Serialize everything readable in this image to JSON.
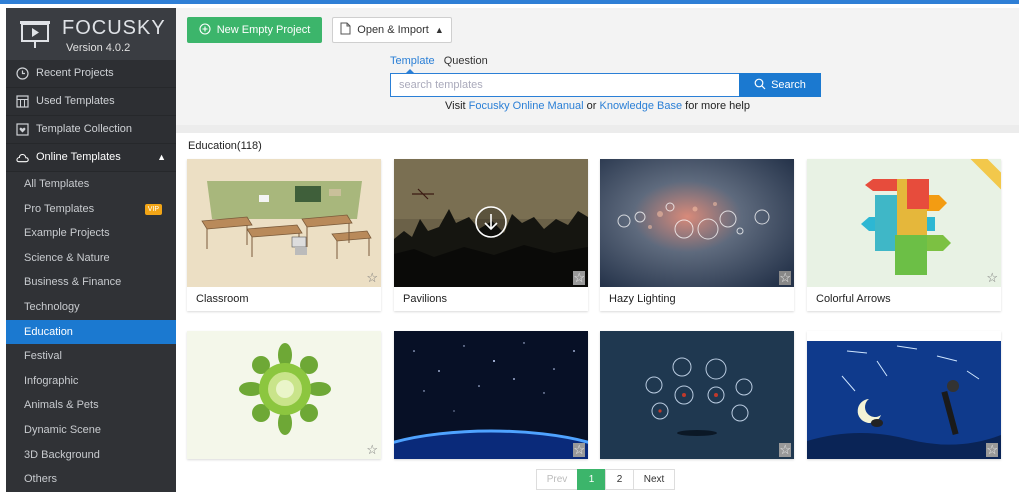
{
  "app": {
    "name": "FOCUSKY",
    "version": "Version 4.0.2"
  },
  "sidebar": {
    "items": [
      {
        "label": "Recent Projects",
        "icon": "clock-icon"
      },
      {
        "label": "Used Templates",
        "icon": "template-grid-icon"
      },
      {
        "label": "Template Collection",
        "icon": "heart-box-icon"
      },
      {
        "label": "Online Templates",
        "icon": "cloud-icon",
        "expanded": true
      }
    ],
    "sub_items": [
      {
        "label": "All Templates"
      },
      {
        "label": "Pro Templates",
        "badge": "VIP"
      },
      {
        "label": "Example Projects"
      },
      {
        "label": "Science & Nature"
      },
      {
        "label": "Business & Finance"
      },
      {
        "label": "Technology"
      },
      {
        "label": "Education",
        "active": true
      },
      {
        "label": "Festival"
      },
      {
        "label": "Infographic"
      },
      {
        "label": "Animals & Pets"
      },
      {
        "label": "Dynamic Scene"
      },
      {
        "label": "3D Background"
      },
      {
        "label": "Others"
      }
    ]
  },
  "toolbar": {
    "new_project": "New Empty Project",
    "open_import": "Open & Import"
  },
  "search": {
    "tabs": [
      "Template",
      "Question"
    ],
    "placeholder": "search templates",
    "button": "Search",
    "help_prefix": "Visit ",
    "help_link1": "Focusky Online Manual",
    "help_mid": " or ",
    "help_link2": "Knowledge Base",
    "help_suffix": " for more help"
  },
  "category": {
    "title": "Education(118)"
  },
  "templates": [
    {
      "name": "Classroom"
    },
    {
      "name": "Pavilions"
    },
    {
      "name": "Hazy Lighting"
    },
    {
      "name": "Colorful Arrows"
    },
    {
      "name": ""
    },
    {
      "name": ""
    },
    {
      "name": ""
    },
    {
      "name": ""
    }
  ],
  "pagination": {
    "prev": "Prev",
    "pages": [
      "1",
      "2"
    ],
    "current": "1",
    "next": "Next"
  },
  "colors": {
    "accent": "#1b79d0",
    "green": "#3cb56b",
    "sidebar": "#2d2f33",
    "vip": "#f2a516"
  }
}
